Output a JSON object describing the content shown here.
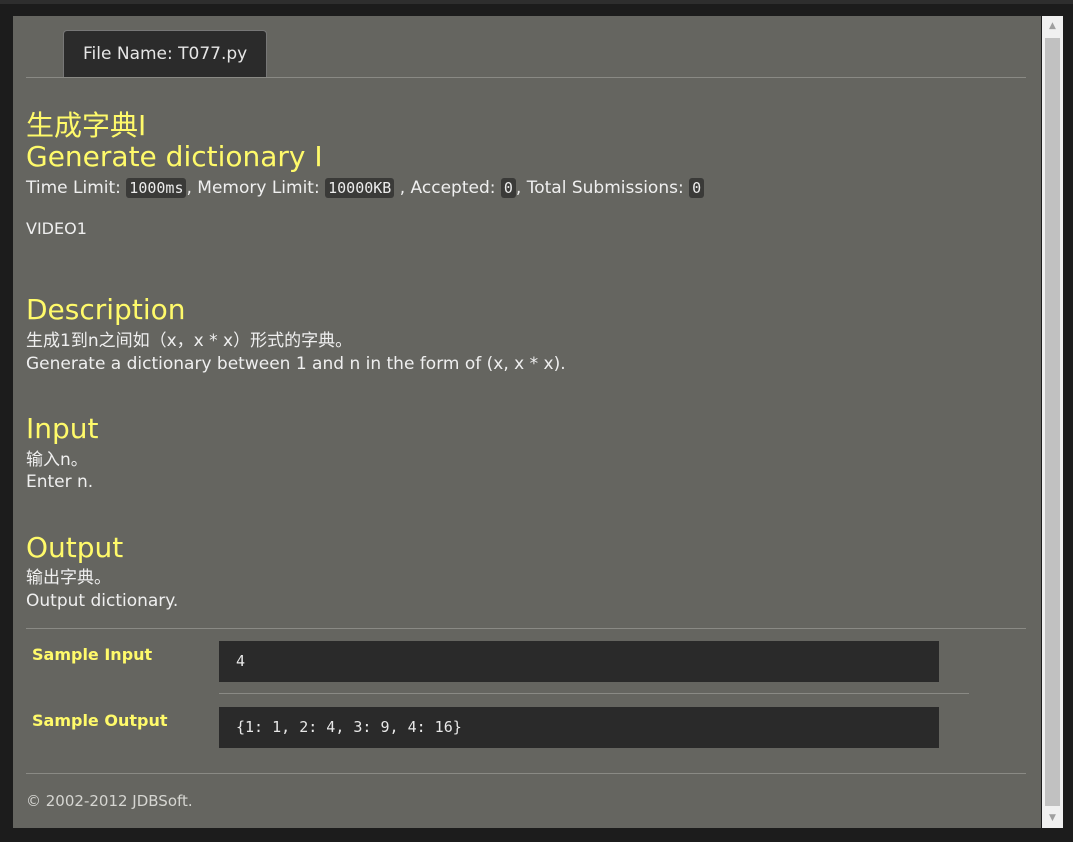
{
  "tab": {
    "label": "File Name:  T077.py"
  },
  "problem": {
    "title_cn": "生成字典I",
    "title_en": "Generate dictionary I",
    "meta": {
      "time_label": "Time Limit:",
      "time_value": "1000ms",
      "memory_label": ", Memory Limit:",
      "memory_value": "10000KB",
      "accepted_label": ", Accepted:",
      "accepted_value": "0",
      "total_label": ", Total Submissions:",
      "total_value": "0"
    },
    "source": "VIDEO1"
  },
  "sections": {
    "description": {
      "heading": "Description",
      "line_cn": "生成1到n之间如（x，x * x）形式的字典。",
      "line_en": "Generate a dictionary between 1 and n in the form of (x, x * x)."
    },
    "input": {
      "heading": "Input",
      "line_cn": "输入n。",
      "line_en": "Enter n."
    },
    "output": {
      "heading": "Output",
      "line_cn": "输出字典。",
      "line_en": "Output dictionary."
    }
  },
  "samples": {
    "input_label": "Sample Input",
    "input_value": "4",
    "output_label": "Sample Output",
    "output_value": "{1: 1, 2: 4, 3: 9, 4: 16}"
  },
  "footer": {
    "text": "© 2002-2012  JDBSoft."
  },
  "colors": {
    "background": "#656560",
    "heading": "#fffa6a",
    "text": "#efefef",
    "code_bg": "#2a2a2a"
  }
}
